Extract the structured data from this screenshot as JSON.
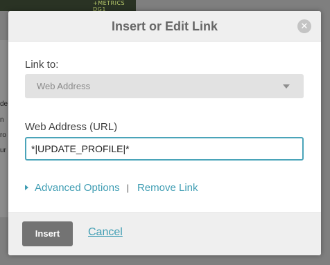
{
  "background": {
    "logo_text": "+METRICS\nDG1",
    "snippets": [
      "de",
      "n ",
      "ro",
      "ur"
    ]
  },
  "modal": {
    "title": "Insert or Edit Link",
    "close_glyph": "✕",
    "link_to": {
      "label": "Link to:",
      "selected": "Web Address"
    },
    "url": {
      "label": "Web Address (URL)",
      "value": "*|UPDATE_PROFILE|*"
    },
    "links": {
      "advanced": "Advanced Options",
      "separator": "|",
      "remove": "Remove Link"
    },
    "footer": {
      "insert_label": "Insert",
      "cancel_label": "Cancel"
    }
  },
  "colors": {
    "accent": "#3f9db3",
    "input_border": "#4aa4b9",
    "insert_button": "#737373"
  }
}
